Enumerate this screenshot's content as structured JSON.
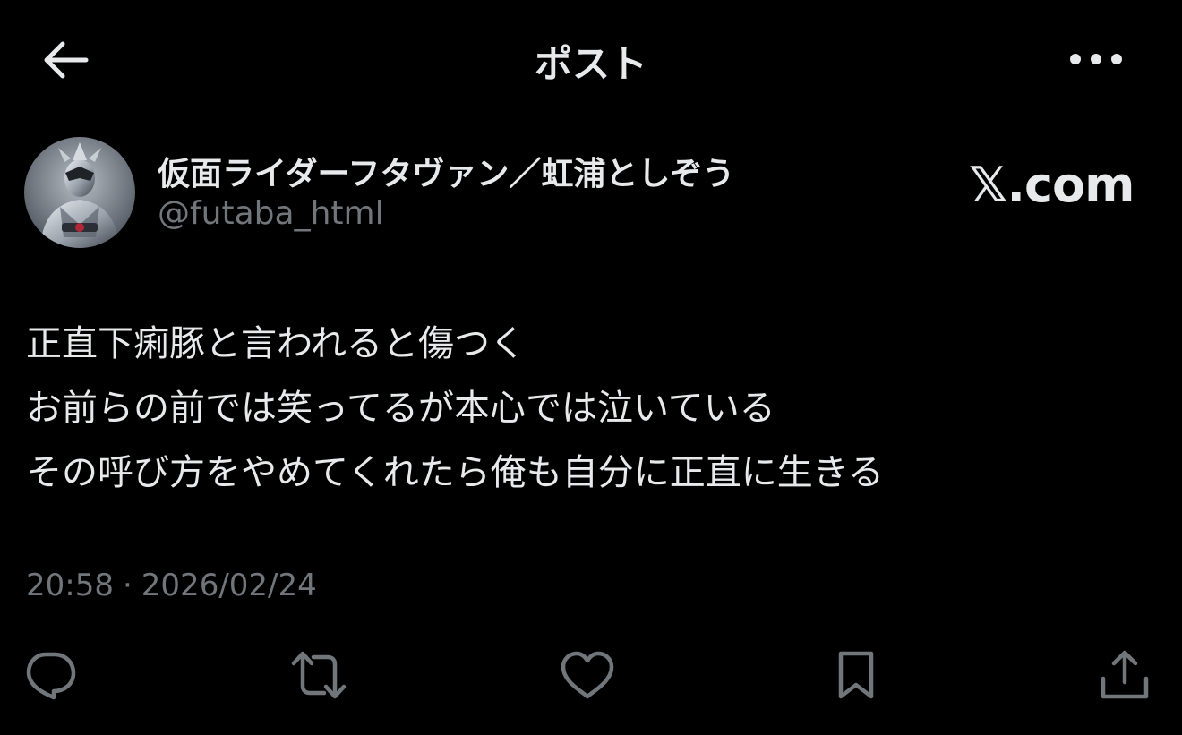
{
  "header": {
    "title": "ポスト",
    "back_icon": "back-arrow-icon",
    "more_icon": "more-horizontal-icon"
  },
  "author": {
    "display_name": "仮面ライダーフタヴァン／虹浦としぞう",
    "handle": "@futaba_html",
    "avatar": "kamen-rider-figure-avatar"
  },
  "watermark": {
    "text": "𝕏.com"
  },
  "post": {
    "lines": [
      "正直下痢豚と言われると傷つく",
      "お前らの前では笑ってるが本心では泣いている",
      "その呼び方をやめてくれたら俺も自分に正直に生きる"
    ],
    "time": "20:58",
    "separator": "·",
    "date": "2026/02/24"
  },
  "actions": [
    {
      "icon": "reply-icon"
    },
    {
      "icon": "repost-icon"
    },
    {
      "icon": "like-icon"
    },
    {
      "icon": "bookmark-icon"
    },
    {
      "icon": "share-icon"
    }
  ],
  "colors": {
    "background": "#000000",
    "text_primary": "#e7e9ea",
    "text_secondary": "#71767b"
  }
}
